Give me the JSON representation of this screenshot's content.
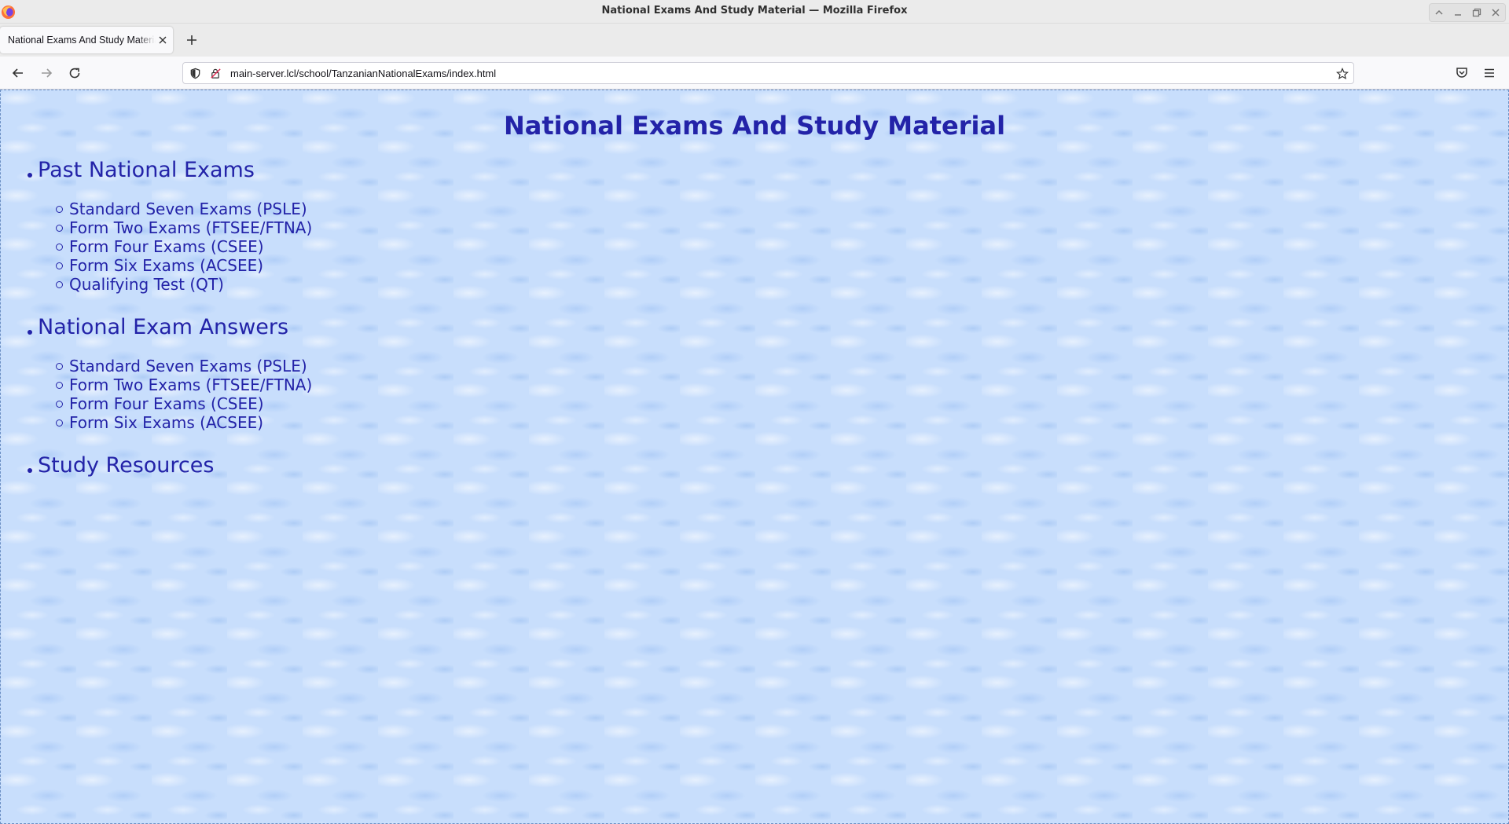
{
  "window": {
    "title": "National Exams And Study Material — Mozilla Firefox"
  },
  "tabs": [
    {
      "label": "National Exams And Study Material"
    }
  ],
  "navbar": {
    "url": "main-server.lcl/school/TanzanianNationalExams/index.html"
  },
  "page": {
    "title": "National Exams And Study Material",
    "sections": [
      {
        "heading": "Past National Exams",
        "items": [
          "Standard Seven Exams (PSLE)",
          "Form Two Exams (FTSEE/FTNA)",
          "Form Four Exams (CSEE)",
          "Form Six Exams (ACSEE)",
          "Qualifying Test (QT)"
        ]
      },
      {
        "heading": "National Exam Answers",
        "items": [
          "Standard Seven Exams (PSLE)",
          "Form Two Exams (FTSEE/FTNA)",
          "Form Four Exams (CSEE)",
          "Form Six Exams (ACSEE)"
        ]
      },
      {
        "heading": "Study Resources",
        "items": []
      }
    ]
  },
  "colors": {
    "text": "#2323a8",
    "background": "#c8defc"
  },
  "icons": {
    "logo": "firefox-logo-icon",
    "back": "back-arrow-icon",
    "forward": "forward-arrow-icon",
    "reload": "reload-icon",
    "tracking": "shield-icon",
    "insecure": "lock-warning-icon",
    "bookmark": "star-icon",
    "pocket": "pocket-icon",
    "menu": "hamburger-menu-icon"
  }
}
